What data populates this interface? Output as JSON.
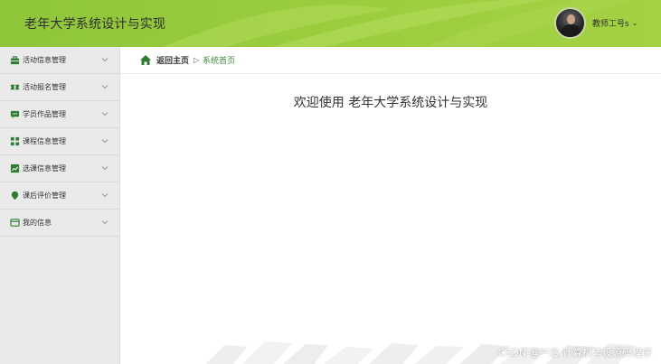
{
  "header": {
    "title": "老年大学系统设计与实现",
    "user_label": "教师工号s"
  },
  "sidebar": {
    "items": [
      {
        "label": "活动信息管理",
        "icon": "briefcase-icon"
      },
      {
        "label": "活动报名管理",
        "icon": "ticket-icon"
      },
      {
        "label": "学员作品管理",
        "icon": "comment-icon"
      },
      {
        "label": "课程信息管理",
        "icon": "grid-icon"
      },
      {
        "label": "选课信息管理",
        "icon": "chart-icon"
      },
      {
        "label": "课后评价管理",
        "icon": "map-pin-icon"
      },
      {
        "label": "我的信息",
        "icon": "card-icon"
      }
    ]
  },
  "breadcrumb": {
    "home": "返回主页",
    "separator": "▷",
    "current": "系统首页"
  },
  "main": {
    "welcome": "欢迎使用 老年大学系统设计与实现"
  },
  "watermark": "CSDN @一念 计算机毕设源码程序",
  "colors": {
    "header_green": "#9ccd3f",
    "icon_green": "#2e7d32",
    "sidebar_bg": "#eaeaea",
    "accent_text": "#3b8a3b"
  }
}
